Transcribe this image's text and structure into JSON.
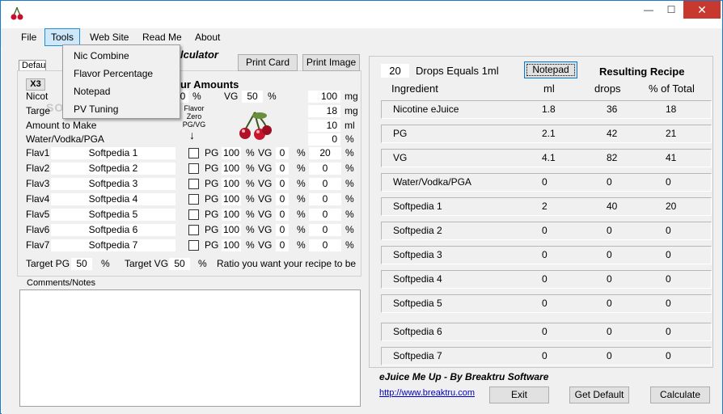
{
  "menu": {
    "file": "File",
    "tools": "Tools",
    "website": "Web Site",
    "readme": "Read Me",
    "about": "About"
  },
  "tools_menu": [
    "Nic Combine",
    "Flavor Percentage",
    "Notepad",
    "PV Tuning"
  ],
  "calculator_title_partial": "lculator",
  "your_amounts_partial": "our Amounts",
  "tab_label": "Defau",
  "x3_label": "X3",
  "buttons": {
    "print_card": "Print Card",
    "print_image": "Print Image",
    "notepad": "Notepad",
    "exit": "Exit",
    "get_default": "Get Default",
    "calculate": "Calculate"
  },
  "rows": {
    "nicotine": {
      "label": "Nicot",
      "pg_value": "0",
      "pct": "%",
      "vg_label": "VG",
      "vg_value": "50",
      "amount": "100",
      "unit": "mg"
    },
    "target": {
      "label": "Targe",
      "amount": "18",
      "unit": "mg"
    },
    "amount_to_make": {
      "label": "Amount to Make",
      "amount": "10",
      "unit": "ml"
    },
    "water": {
      "label": "Water/Vodka/PGA",
      "amount": "0",
      "unit": "%"
    }
  },
  "flavor_zero": [
    "Flavor",
    "Zero",
    "PG/VG"
  ],
  "flavors": [
    {
      "label": "Flav1",
      "name": "Softpedia 1",
      "pg": "100",
      "vg": "0",
      "pct": "20"
    },
    {
      "label": "Flav2",
      "name": "Softpedia 2",
      "pg": "100",
      "vg": "0",
      "pct": "0"
    },
    {
      "label": "Flav3",
      "name": "Softpedia 3",
      "pg": "100",
      "vg": "0",
      "pct": "0"
    },
    {
      "label": "Flav4",
      "name": "Softpedia 4",
      "pg": "100",
      "vg": "0",
      "pct": "0"
    },
    {
      "label": "Flav5",
      "name": "Softpedia  5",
      "pg": "100",
      "vg": "0",
      "pct": "0"
    },
    {
      "label": "Flav6",
      "name": "Softpedia  6",
      "pg": "100",
      "vg": "0",
      "pct": "0"
    },
    {
      "label": "Flav7",
      "name": "Softpedia  7",
      "pg": "100",
      "vg": "0",
      "pct": "0"
    }
  ],
  "flavor_labels": {
    "pg": "PG",
    "vg": "VG",
    "pct": "%"
  },
  "target_line": {
    "target_pg_label": "Target PG",
    "target_pg": "50",
    "target_vg_label": "Target VG",
    "target_vg": "50",
    "pct": "%",
    "ratio_text": "Ratio you want your recipe to be"
  },
  "comments_label": "Comments/Notes",
  "drops": {
    "value": "20",
    "label": "Drops Equals 1ml"
  },
  "resulting_recipe": "Resulting Recipe",
  "recipe_headers": {
    "ingredient": "Ingredient",
    "ml": "ml",
    "drops": "drops",
    "pct_total": "% of Total"
  },
  "recipe": [
    {
      "ingredient": "Nicotine eJuice",
      "ml": "1.8",
      "drops": "36",
      "pct": "18"
    },
    {
      "ingredient": "PG",
      "ml": "2.1",
      "drops": "42",
      "pct": "21"
    },
    {
      "ingredient": "VG",
      "ml": "4.1",
      "drops": "82",
      "pct": "41"
    },
    {
      "ingredient": "Water/Vodka/PGA",
      "ml": "0",
      "drops": "0",
      "pct": "0"
    },
    {
      "ingredient": "Softpedia 1",
      "ml": "2",
      "drops": "40",
      "pct": "20"
    },
    {
      "ingredient": "Softpedia 2",
      "ml": "0",
      "drops": "0",
      "pct": "0"
    },
    {
      "ingredient": "Softpedia 3",
      "ml": "0",
      "drops": "0",
      "pct": "0"
    },
    {
      "ingredient": "Softpedia 4",
      "ml": "0",
      "drops": "0",
      "pct": "0"
    },
    {
      "ingredient": "Softpedia  5",
      "ml": "0",
      "drops": "0",
      "pct": "0"
    },
    {
      "ingredient": "Softpedia  6",
      "ml": "0",
      "drops": "0",
      "pct": "0"
    },
    {
      "ingredient": "Softpedia  7",
      "ml": "0",
      "drops": "0",
      "pct": "0"
    }
  ],
  "credit": "eJuice Me Up -  By Breaktru Software",
  "link": "http://www.breaktru.com",
  "watermark": "SOFTPEDIA",
  "colors": {
    "accent": "#0078d7",
    "close": "#c7382f",
    "menu_highlight": "#cde8fb"
  }
}
